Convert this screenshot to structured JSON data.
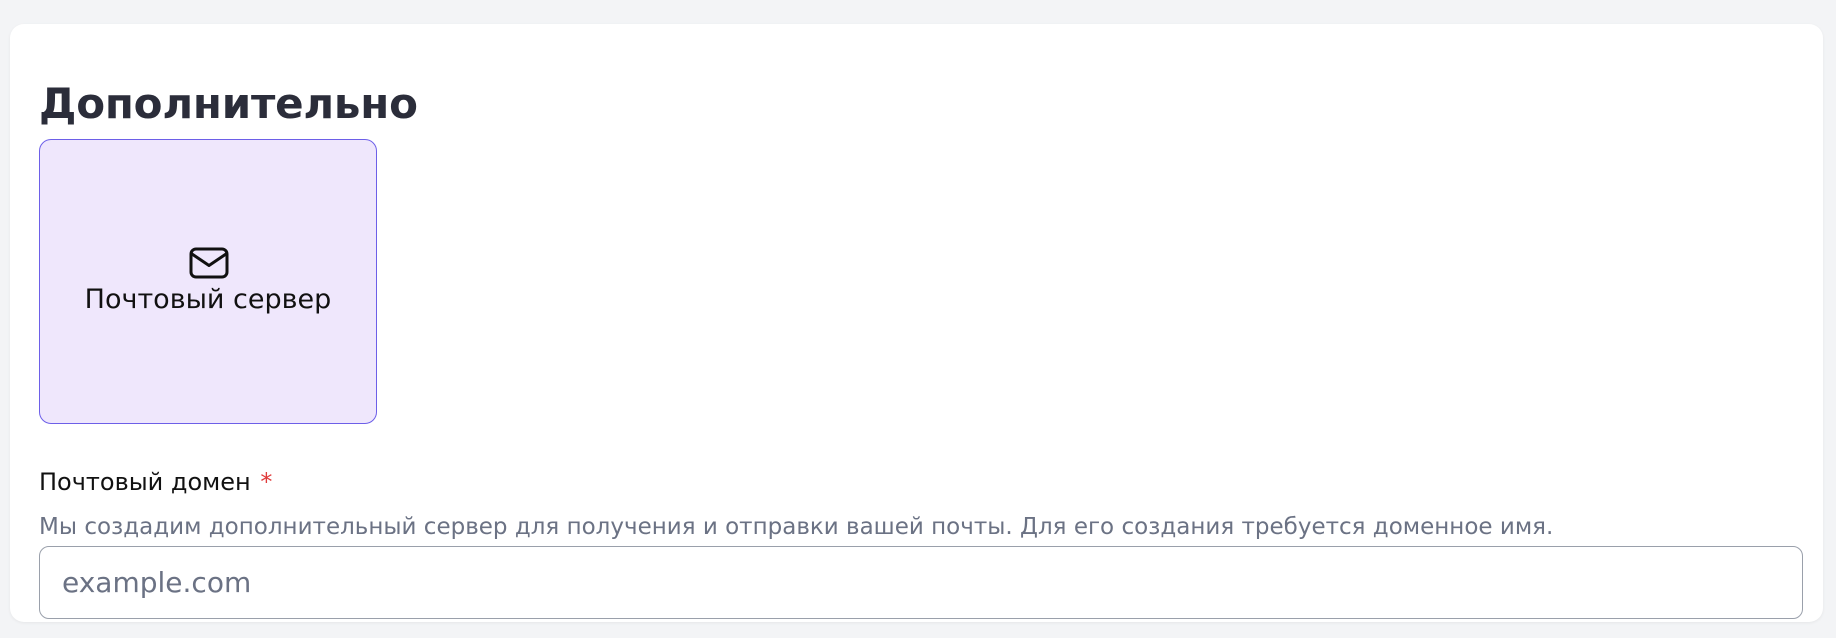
{
  "section": {
    "title": "Дополнительно"
  },
  "options": [
    {
      "label": "Почтовый сервер",
      "icon": "envelope-icon",
      "selected": true
    }
  ],
  "mail_domain_field": {
    "label": "Почтовый домен",
    "required_marker": "*",
    "hint": "Мы создадим дополнительный сервер для получения и отправки вашей почты. Для его создания требуется доменное имя.",
    "placeholder": "example.com",
    "value": ""
  },
  "colors": {
    "page_background": "#f3f4f6",
    "panel_background": "#ffffff",
    "selected_card_background": "#efe7fc",
    "selected_card_border": "#6d5fe8",
    "required_star": "#e03b3b",
    "hint_text": "#6b7284",
    "title_text": "#2b2d3a"
  }
}
